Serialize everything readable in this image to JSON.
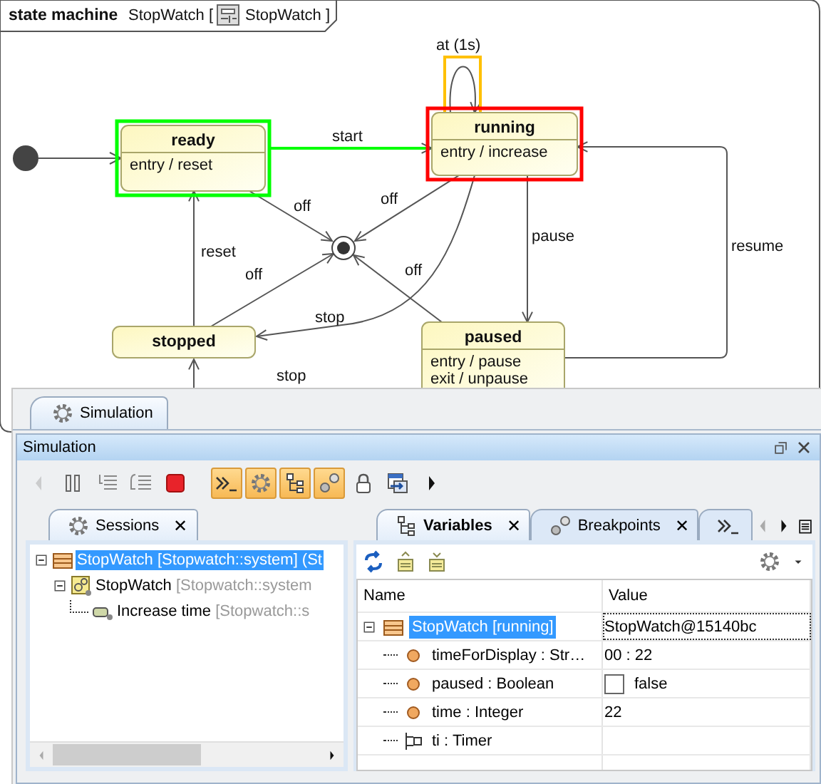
{
  "diagram": {
    "kind": "state machine",
    "name": "StopWatch [",
    "owner": "StopWatch ]",
    "states": [
      {
        "name": "ready",
        "behaviors": [
          "entry / reset"
        ],
        "color": "#00ff00"
      },
      {
        "name": "running",
        "behaviors": [
          "entry / increase"
        ],
        "color": "#ff0000"
      },
      {
        "name": "stopped"
      },
      {
        "name": "paused",
        "behaviors": [
          "entry / pause",
          "exit / unpause"
        ]
      }
    ],
    "transitions": [
      {
        "label": "at (1s)",
        "color": "#ffc000"
      },
      {
        "label": "start",
        "color": "#00ff00"
      },
      {
        "label": "off"
      },
      {
        "label": "off"
      },
      {
        "label": "reset"
      },
      {
        "label": "pause"
      },
      {
        "label": "resume"
      },
      {
        "label": "off"
      },
      {
        "label": "off"
      },
      {
        "label": "stop"
      },
      {
        "label": "stop"
      }
    ]
  },
  "panel": {
    "tab": {
      "label": "Simulation",
      "selected": true
    },
    "title": "Simulation",
    "toolbar": [
      {
        "kind": "back",
        "disabled": true,
        "pressed": false
      },
      {
        "kind": "pause",
        "disabled": false,
        "pressed": false
      },
      {
        "kind": "step-into",
        "disabled": false,
        "pressed": false
      },
      {
        "kind": "step-out",
        "disabled": false,
        "pressed": false
      },
      {
        "kind": "stop",
        "disabled": false,
        "pressed": false
      },
      {
        "kind": "console",
        "disabled": false,
        "pressed": true
      },
      {
        "kind": "animation",
        "disabled": false,
        "pressed": true
      },
      {
        "kind": "variables",
        "disabled": false,
        "pressed": true
      },
      {
        "kind": "breakpoints",
        "disabled": false,
        "pressed": true
      },
      {
        "kind": "lock",
        "disabled": false,
        "pressed": false
      },
      {
        "kind": "export",
        "disabled": false,
        "pressed": false
      },
      {
        "kind": "forward",
        "disabled": false,
        "pressed": false
      }
    ],
    "sessions": {
      "tab": {
        "label": "Sessions",
        "close": "✕",
        "selected": true
      },
      "items": [
        {
          "label": "StopWatch",
          "detail": "[Stopwatch::system] (St",
          "kind": "session",
          "selected": true,
          "expanded": true,
          "children": [
            {
              "label": "StopWatch",
              "detail": "[Stopwatch::system",
              "kind": "behavior",
              "selected": false,
              "expanded": true,
              "children": [
                {
                  "label": "Increase time",
                  "detail": "[Stopwatch::s",
                  "kind": "action",
                  "selected": false
                }
              ]
            }
          ]
        }
      ]
    },
    "variables": {
      "tabs": [
        {
          "label": "Variables",
          "kind": "variables",
          "close": "✕",
          "selected": true
        },
        {
          "label": "Breakpoints",
          "kind": "breakpoints",
          "close": "✕",
          "selected": false
        },
        {
          "kind": "console",
          "selected": false
        }
      ],
      "columns": [
        "Name",
        "Value"
      ],
      "rows": [
        {
          "name": "StopWatch [running]",
          "value": "StopWatch@15140bc",
          "kind": "instance",
          "selected": true,
          "expanded": true,
          "children": [
            {
              "name": "timeForDisplay : Str…",
              "value": "00 : 22",
              "kind": "attribute",
              "selected": false
            },
            {
              "name": "paused : Boolean",
              "value": "false",
              "kind": "boolean",
              "checked": false,
              "selected": false
            },
            {
              "name": "time : Integer",
              "value": "22",
              "kind": "attribute",
              "selected": false
            },
            {
              "name": "ti : Timer",
              "kind": "port",
              "selected": false
            }
          ]
        }
      ]
    }
  }
}
